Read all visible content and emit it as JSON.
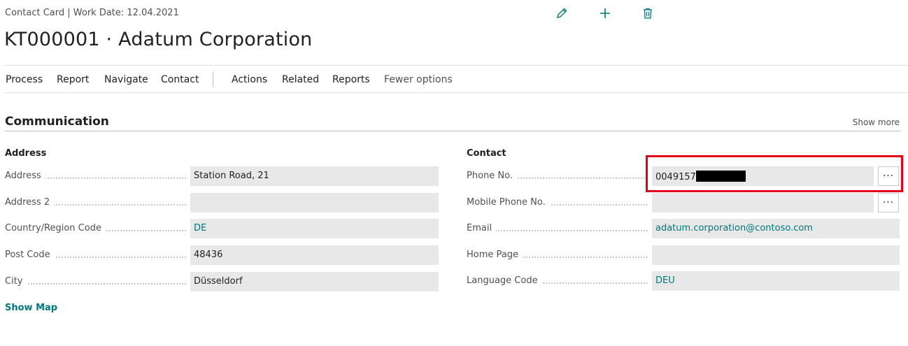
{
  "header": {
    "breadcrumb": "Contact Card | Work Date: 12.04.2021",
    "title": "KT000001 · Adatum Corporation"
  },
  "toolbar_icons": [
    "edit-icon",
    "new-icon",
    "delete-icon"
  ],
  "actionbar": {
    "items": [
      "Process",
      "Report",
      "Navigate",
      "Contact",
      "Actions",
      "Related",
      "Reports",
      "Fewer options"
    ]
  },
  "section": {
    "title": "Communication",
    "show_more": "Show more"
  },
  "address": {
    "title": "Address",
    "fields": [
      {
        "label": "Address",
        "value": "Station Road, 21"
      },
      {
        "label": "Address 2",
        "value": ""
      },
      {
        "label": "Country/Region Code",
        "value": "DE"
      },
      {
        "label": "Post Code",
        "value": "48436"
      },
      {
        "label": "City",
        "value": "Düsseldorf"
      }
    ],
    "show_map": "Show Map"
  },
  "contact": {
    "title": "Contact",
    "fields": [
      {
        "label": "Phone No.",
        "value": "0049157"
      },
      {
        "label": "Mobile Phone No.",
        "value": ""
      },
      {
        "label": "Email",
        "value": "adatum.corporation@contoso.com"
      },
      {
        "label": "Home Page",
        "value": ""
      },
      {
        "label": "Language Code",
        "value": "DEU"
      }
    ],
    "assist_label": "···"
  },
  "colors": {
    "accent": "#00777a",
    "highlight": "#e0001b"
  }
}
